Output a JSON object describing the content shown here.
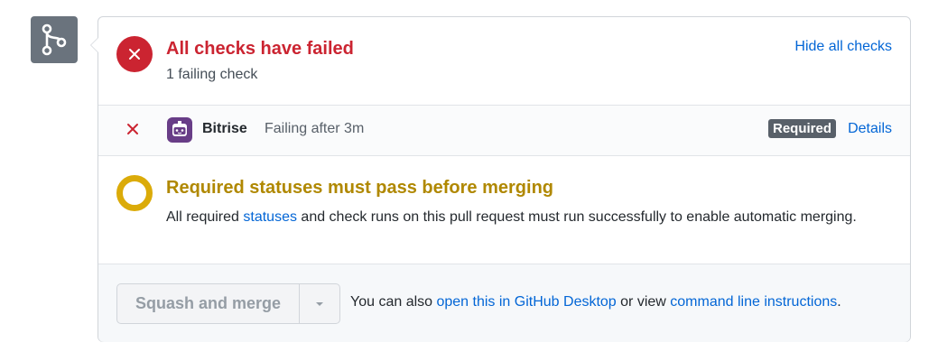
{
  "status": {
    "title": "All checks have failed",
    "subtitle": "1 failing check",
    "hide_link": "Hide all checks"
  },
  "check": {
    "name": "Bitrise",
    "description": "Failing after 3m",
    "badge": "Required",
    "details_link": "Details"
  },
  "requirement": {
    "title": "Required statuses must pass before merging",
    "body_prefix": "All required ",
    "statuses_link": "statuses",
    "body_suffix": " and check runs on this pull request must run successfully to enable automatic merging."
  },
  "merge": {
    "button_label": "Squash and merge",
    "note_prefix": "You can also ",
    "desktop_link": "open this in GitHub Desktop",
    "note_middle": " or view ",
    "cli_link": "command line instructions",
    "note_suffix": "."
  },
  "icons": {
    "merge": "git-merge-icon",
    "fail": "x-circle-icon",
    "check_fail": "x-icon",
    "app": "bitrise-logo-icon",
    "pending": "pending-ring-icon",
    "dropdown": "triangle-down-icon"
  },
  "colors": {
    "fail": "#cb2431",
    "pending": "#dbab09",
    "pending_text": "#b08800",
    "link": "#0366d6",
    "bitrise": "#683d87"
  }
}
